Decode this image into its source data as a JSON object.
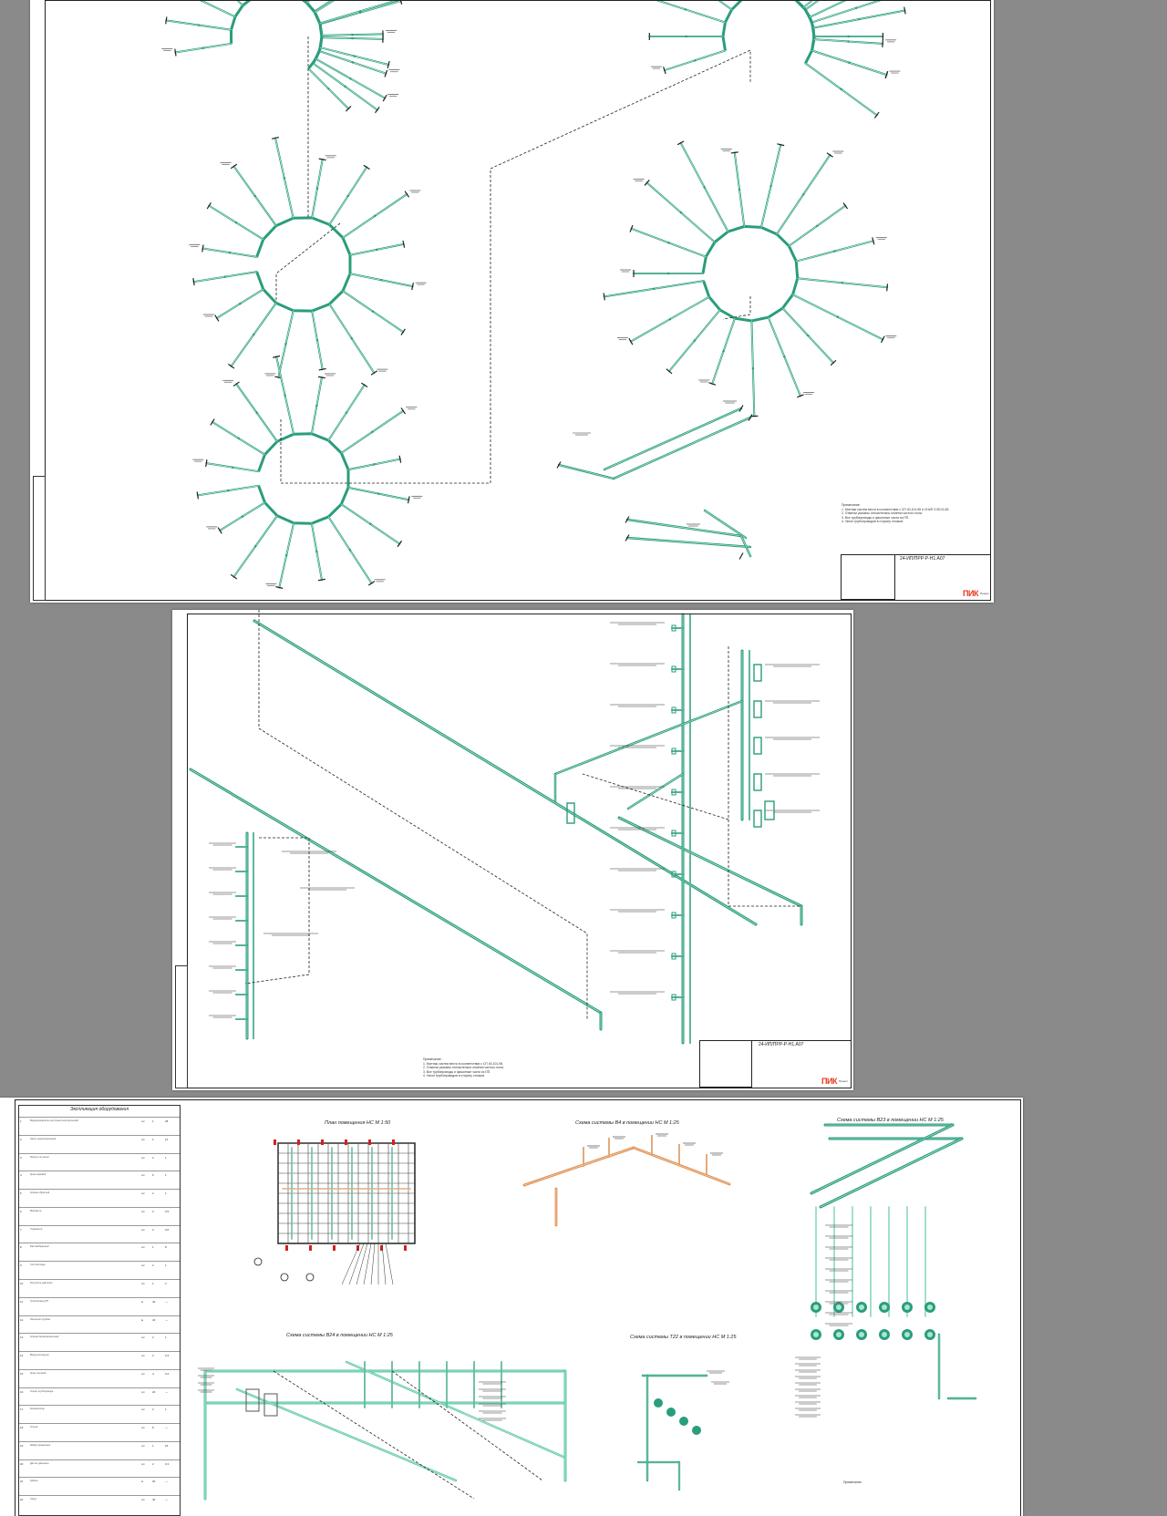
{
  "colors": {
    "background": "#8a8a8a",
    "sheet": "#ffffff",
    "pipe": "#2a9d7c",
    "pipe_light": "#5cc7a6",
    "pipe_orange": "#e88a4a",
    "line": "#222222",
    "leader": "#333333",
    "logo": "#e53a1e",
    "stamp": "#2563c9"
  },
  "sheet1": {
    "title_code": "24-ИП/ПРР-Р-Н1.А07",
    "logo": "ПИК",
    "logo_sub": "Проект",
    "notes_header": "Примечание:",
    "notes": [
      "1. Монтаж систем вести в соответствии с СП 40-101-96 и СНиП 3.05.01-85.",
      "2. Отметки указаны относительно отметки чистого пола.",
      "3. Все трубопроводы и фасонные части из ПП.",
      "4. Уклон трубопроводов в сторону стояков."
    ]
  },
  "sheet2": {
    "title_code": "24-ИП/ПРР-Р-Н1.А07",
    "logo": "ПИК",
    "logo_sub": "Проект",
    "notes_header": "Примечание:",
    "notes": [
      "1. Монтаж систем вести в соответствии с СП 40-101-96.",
      "2. Отметки указаны относительно отметки чистого пола.",
      "3. Все трубопроводы и фасонные части из ПП.",
      "4. Уклон трубопроводов в сторону стояков."
    ]
  },
  "sheet3": {
    "spec_title": "Экспликация оборудования",
    "spec_rows": [
      {
        "num": "1",
        "desc": "Водонагреватель проточный электрический",
        "unit": "шт",
        "qty": "1",
        "mass": "28"
      },
      {
        "num": "2",
        "desc": "Насос циркуляционный",
        "unit": "шт",
        "qty": "1",
        "mass": "12"
      },
      {
        "num": "3",
        "desc": "Фильтр сетчатый",
        "unit": "шт",
        "qty": "2",
        "mass": "1"
      },
      {
        "num": "4",
        "desc": "Кран шаровой",
        "unit": "шт",
        "qty": "6",
        "mass": "1"
      },
      {
        "num": "5",
        "desc": "Клапан обратный",
        "unit": "шт",
        "qty": "2",
        "mass": "1"
      },
      {
        "num": "6",
        "desc": "Манометр",
        "unit": "шт",
        "qty": "2",
        "mass": "0.5"
      },
      {
        "num": "7",
        "desc": "Термометр",
        "unit": "шт",
        "qty": "2",
        "mass": "0.5"
      },
      {
        "num": "8",
        "desc": "Бак мембранный",
        "unit": "шт",
        "qty": "1",
        "mass": "8"
      },
      {
        "num": "9",
        "desc": "Счётчик воды",
        "unit": "шт",
        "qty": "2",
        "mass": "1"
      },
      {
        "num": "10",
        "desc": "Регулятор давления",
        "unit": "шт",
        "qty": "1",
        "mass": "2"
      },
      {
        "num": "11",
        "desc": "Трубопровод ПП",
        "unit": "м",
        "qty": "40",
        "mass": "—"
      },
      {
        "num": "12",
        "desc": "Изоляция трубная",
        "unit": "м",
        "qty": "40",
        "mass": "—"
      },
      {
        "num": "13",
        "desc": "Клапан балансировочный",
        "unit": "шт",
        "qty": "2",
        "mass": "1"
      },
      {
        "num": "14",
        "desc": "Воздухоотводчик",
        "unit": "шт",
        "qty": "2",
        "mass": "0.3"
      },
      {
        "num": "15",
        "desc": "Кран спускной",
        "unit": "шт",
        "qty": "4",
        "mass": "0.2"
      },
      {
        "num": "16",
        "desc": "Опора трубопровода",
        "unit": "шт",
        "qty": "20",
        "mass": "—"
      },
      {
        "num": "17",
        "desc": "Компенсатор",
        "unit": "шт",
        "qty": "2",
        "mass": "1"
      },
      {
        "num": "18",
        "desc": "Гильза",
        "unit": "шт",
        "qty": "8",
        "mass": "—"
      },
      {
        "num": "19",
        "desc": "Шкаф управления",
        "unit": "шт",
        "qty": "1",
        "mass": "15"
      },
      {
        "num": "20",
        "desc": "Датчик давления",
        "unit": "шт",
        "qty": "2",
        "mass": "0.3"
      },
      {
        "num": "21",
        "desc": "Кабель",
        "unit": "м",
        "qty": "30",
        "mass": "—"
      },
      {
        "num": "22",
        "desc": "Хомут",
        "unit": "шт",
        "qty": "40",
        "mass": "—"
      }
    ],
    "captions": {
      "plan": "План помещения НС М 1:50",
      "b4": "Схема системы В4 в помещении НС М 1:25",
      "b23": "Схема системы В23 в помещении НС М 1:25",
      "b24": "Схема системы В24 в помещении НС М 1:25",
      "t22": "Схема системы Т22 в помещении НС М 1:25"
    },
    "notes_header": "Примечание:"
  }
}
